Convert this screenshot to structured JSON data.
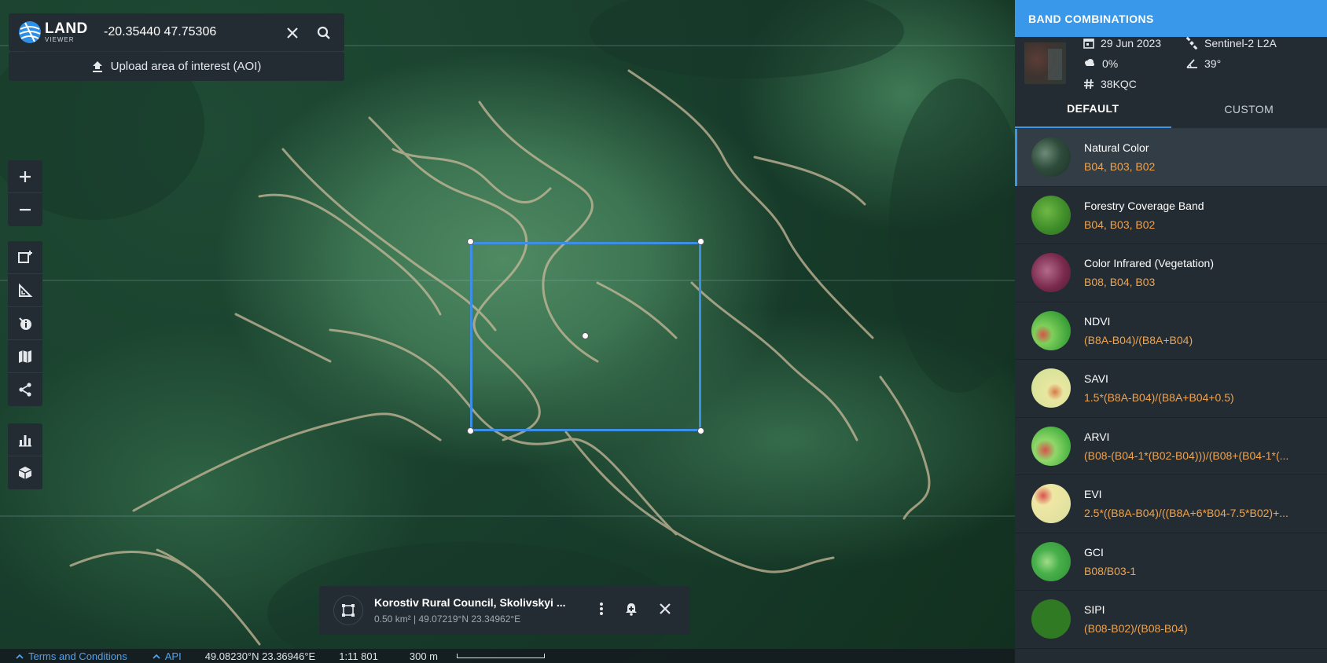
{
  "search": {
    "logo_main": "LAND",
    "logo_sub": "VIEWER",
    "value": "-20.35440 47.75306",
    "upload_label": "Upload area of interest (AOI)"
  },
  "aoi": {
    "title": "Korostiv Rural Council, Skolivskyi ...",
    "meta": "0.50 km² | 49.07219°N 23.34962°E"
  },
  "status_bar": {
    "terms_label": "Terms and Conditions",
    "api_label": "API",
    "coords": "49.08230°N 23.36946°E",
    "scale_ratio": "1:11 801",
    "scale_distance": "300 m"
  },
  "panel": {
    "header": "BAND COMBINATIONS",
    "scene": {
      "date": "29 Jun 2023",
      "satellite": "Sentinel-2 L2A",
      "cloud": "0%",
      "angle": "39°",
      "tile": "38KQC"
    },
    "tabs": [
      {
        "label": "DEFAULT",
        "active": true
      },
      {
        "label": "CUSTOM",
        "active": false
      }
    ],
    "bands": [
      {
        "name": "Natural Color",
        "formula": "B04, B03, B02",
        "thumb": "natural-color"
      },
      {
        "name": "Forestry Coverage Band",
        "formula": "B04, B03, B02",
        "thumb": "forestry"
      },
      {
        "name": "Color Infrared (Vegetation)",
        "formula": "B08, B04, B03",
        "thumb": "infrared"
      },
      {
        "name": "NDVI",
        "formula": "(B8A-B04)/(B8A+B04)",
        "thumb": "ndvi"
      },
      {
        "name": "SAVI",
        "formula": "1.5*(B8A-B04)/(B8A+B04+0.5)",
        "thumb": "savi"
      },
      {
        "name": "ARVI",
        "formula": "(B08-(B04-1*(B02-B04)))/(B08+(B04-1*(...",
        "thumb": "arvi"
      },
      {
        "name": "EVI",
        "formula": "2.5*((B8A-B04)/((B8A+6*B04-7.5*B02)+...",
        "thumb": "evi"
      },
      {
        "name": "GCI",
        "formula": "B08/B03-1",
        "thumb": "gci"
      },
      {
        "name": "SIPI",
        "formula": "(B08-B02)/(B08-B04)",
        "thumb": "sipi"
      }
    ]
  },
  "colors": {
    "accent": "#3a98ea",
    "formula": "#f0a34e",
    "panel_bg": "#232c33"
  }
}
